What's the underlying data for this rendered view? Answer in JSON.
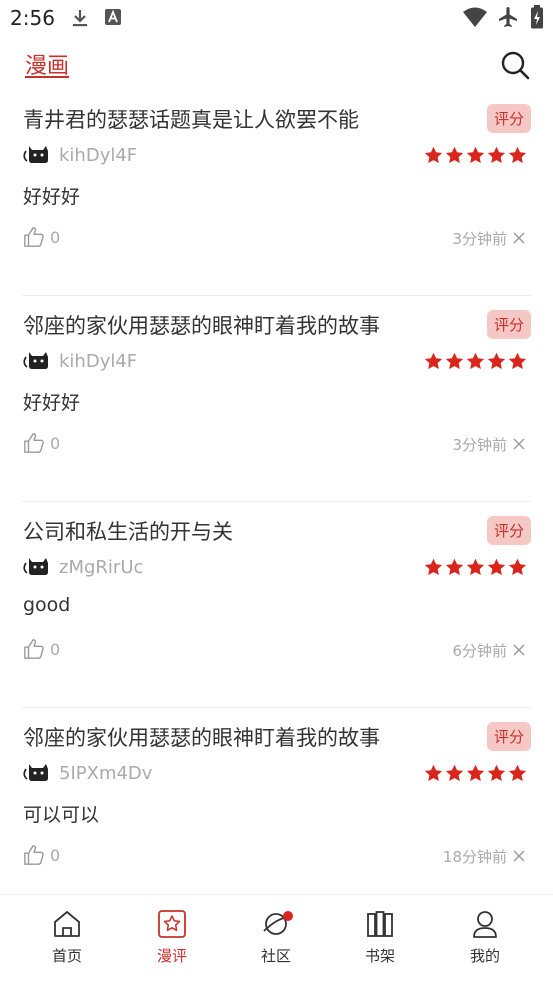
{
  "status_bar": {
    "time": "2:56",
    "icons": [
      "download-icon",
      "a-icon",
      "wifi-icon",
      "airplane-icon",
      "battery-icon"
    ]
  },
  "header": {
    "active_tab": "漫画",
    "search_icon": "search-icon"
  },
  "reviews": [
    {
      "title": "青井君的瑟瑟话题真是让人欲罢不能",
      "badge": "评分",
      "user": "kihDyl4F",
      "stars": 5,
      "content": "好好好",
      "likes": "0",
      "time": "3分钟前"
    },
    {
      "title": "邻座的家伙用瑟瑟的眼神盯着我的故事",
      "badge": "评分",
      "user": "kihDyl4F",
      "stars": 5,
      "content": "好好好",
      "likes": "0",
      "time": "3分钟前"
    },
    {
      "title": "公司和私生活的开与关",
      "badge": "评分",
      "user": "zMgRirUc",
      "stars": 5,
      "content": "good",
      "likes": "0",
      "time": "6分钟前"
    },
    {
      "title": "邻座的家伙用瑟瑟的眼神盯着我的故事",
      "badge": "评分",
      "user": "5IPXm4Dv",
      "stars": 5,
      "content": "可以可以",
      "likes": "0",
      "time": "18分钟前"
    }
  ],
  "bottom_nav": [
    {
      "label": "首页",
      "icon": "home-icon",
      "active": false
    },
    {
      "label": "漫评",
      "icon": "review-star-icon",
      "active": true
    },
    {
      "label": "社区",
      "icon": "planet-icon",
      "active": false,
      "badge_dot": true
    },
    {
      "label": "书架",
      "icon": "bookshelf-icon",
      "active": false
    },
    {
      "label": "我的",
      "icon": "profile-icon",
      "active": false
    }
  ],
  "colors": {
    "accent": "#c8312b",
    "badge_bg": "#f6c8c5",
    "star": "#d9261c",
    "muted": "#aaaaaa"
  }
}
